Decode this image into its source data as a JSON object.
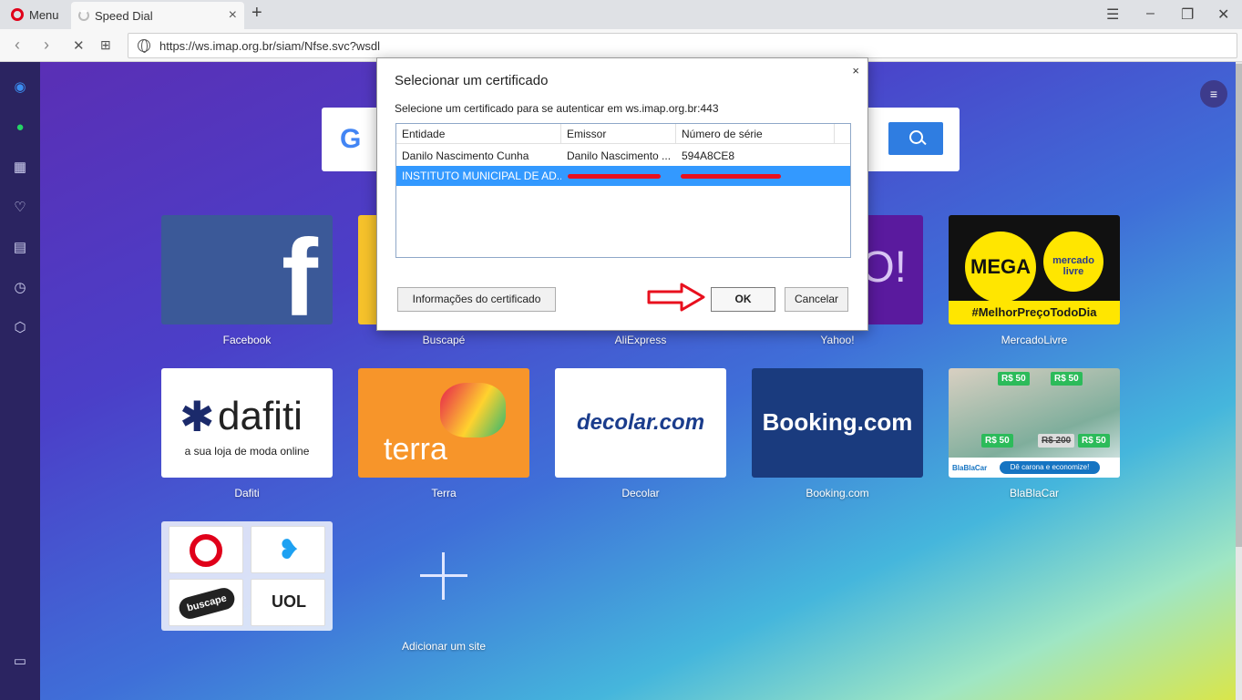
{
  "browser": {
    "menu_label": "Menu",
    "tab_title": "Speed Dial",
    "url": "https://ws.imap.org.br/siam/Nfse.svc?wsdl"
  },
  "speed_dial": {
    "tiles": [
      {
        "label": "Facebook"
      },
      {
        "label": "Buscapé"
      },
      {
        "label": "AliExpress"
      },
      {
        "label": "Yahoo!"
      },
      {
        "label": "MercadoLivre"
      },
      {
        "label": "Dafiti"
      },
      {
        "label": "Terra"
      },
      {
        "label": "Decolar"
      },
      {
        "label": "Booking.com"
      },
      {
        "label": "BlaBlaCar"
      }
    ],
    "add_site_label": "Adicionar um site",
    "mercado_banner": "#MelhorPreçoTodoDia",
    "mercado_mega": "MEGA",
    "mercado_badge": "mercado livre",
    "dafiti_word": "dafiti",
    "dafiti_tagline": "a sua loja de moda online",
    "terra_word": "terra",
    "decolar_word": "decolar.com",
    "booking_word": "Booking.com",
    "blabla_tag": "R$ 50",
    "blabla_tag_old": "R$ 200",
    "blabla_slogan": "Dê carona e economize!",
    "blabla_logo": "BlaBlaCar",
    "yahoo_fragment": "O!",
    "folder_buscape": "buscape",
    "folder_uol": "UOL"
  },
  "dialog": {
    "title": "Selecionar um certificado",
    "subtitle": "Selecione um certificado para se autenticar em ws.imap.org.br:443",
    "columns": [
      "Entidade",
      "Emissor",
      "Número de série"
    ],
    "rows": [
      {
        "entity": "Danilo Nascimento Cunha",
        "issuer": "Danilo Nascimento ...",
        "serial": "594A8CE8"
      },
      {
        "entity": "INSTITUTO MUNICIPAL DE AD...",
        "issuer": "",
        "serial": ""
      }
    ],
    "info_button": "Informações do certificado",
    "ok_button": "OK",
    "cancel_button": "Cancelar",
    "close_glyph": "×"
  },
  "colors": {
    "selection": "#3399ff",
    "annotation": "#e8101e",
    "sidebar": "#2b2461"
  }
}
